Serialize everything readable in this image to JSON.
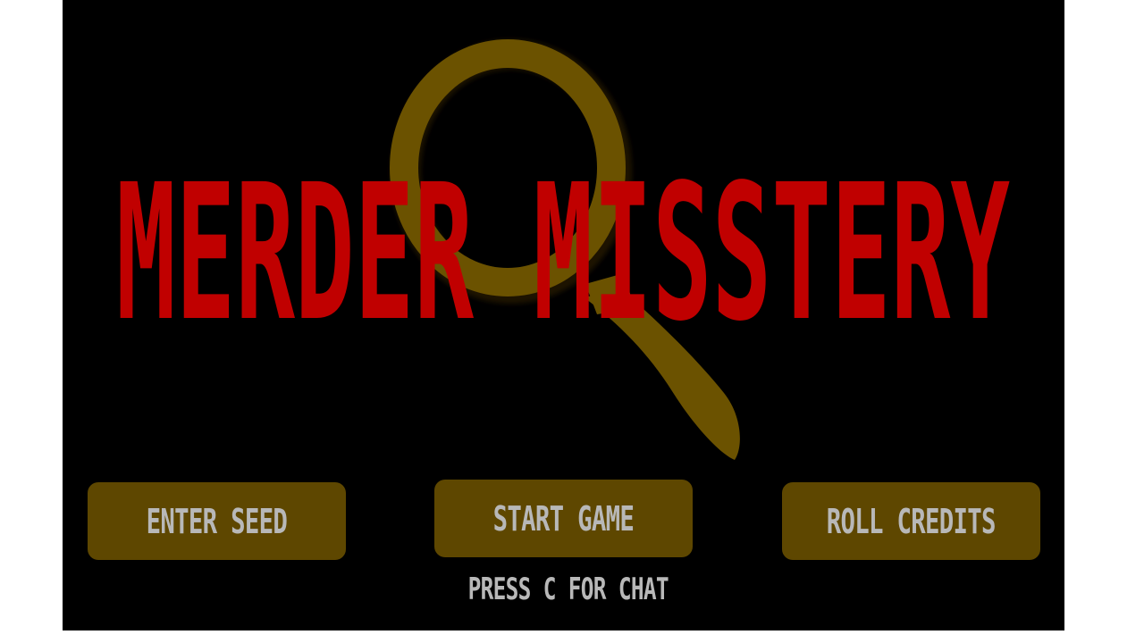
{
  "game": {
    "title": "MERDER MISSTERY",
    "hint": "PRESS C FOR CHAT",
    "buttons": {
      "enter_seed": "ENTER SEED",
      "start_game": "START GAME",
      "roll_credits": "ROLL CREDITS"
    }
  },
  "colors": {
    "background": "#000000",
    "title": "#c00000",
    "magnifier": "#6b5200",
    "button": "#5e4700",
    "button_text": "#b8b8b8"
  },
  "icons": {
    "background_art": "magnifying-glass-icon"
  }
}
